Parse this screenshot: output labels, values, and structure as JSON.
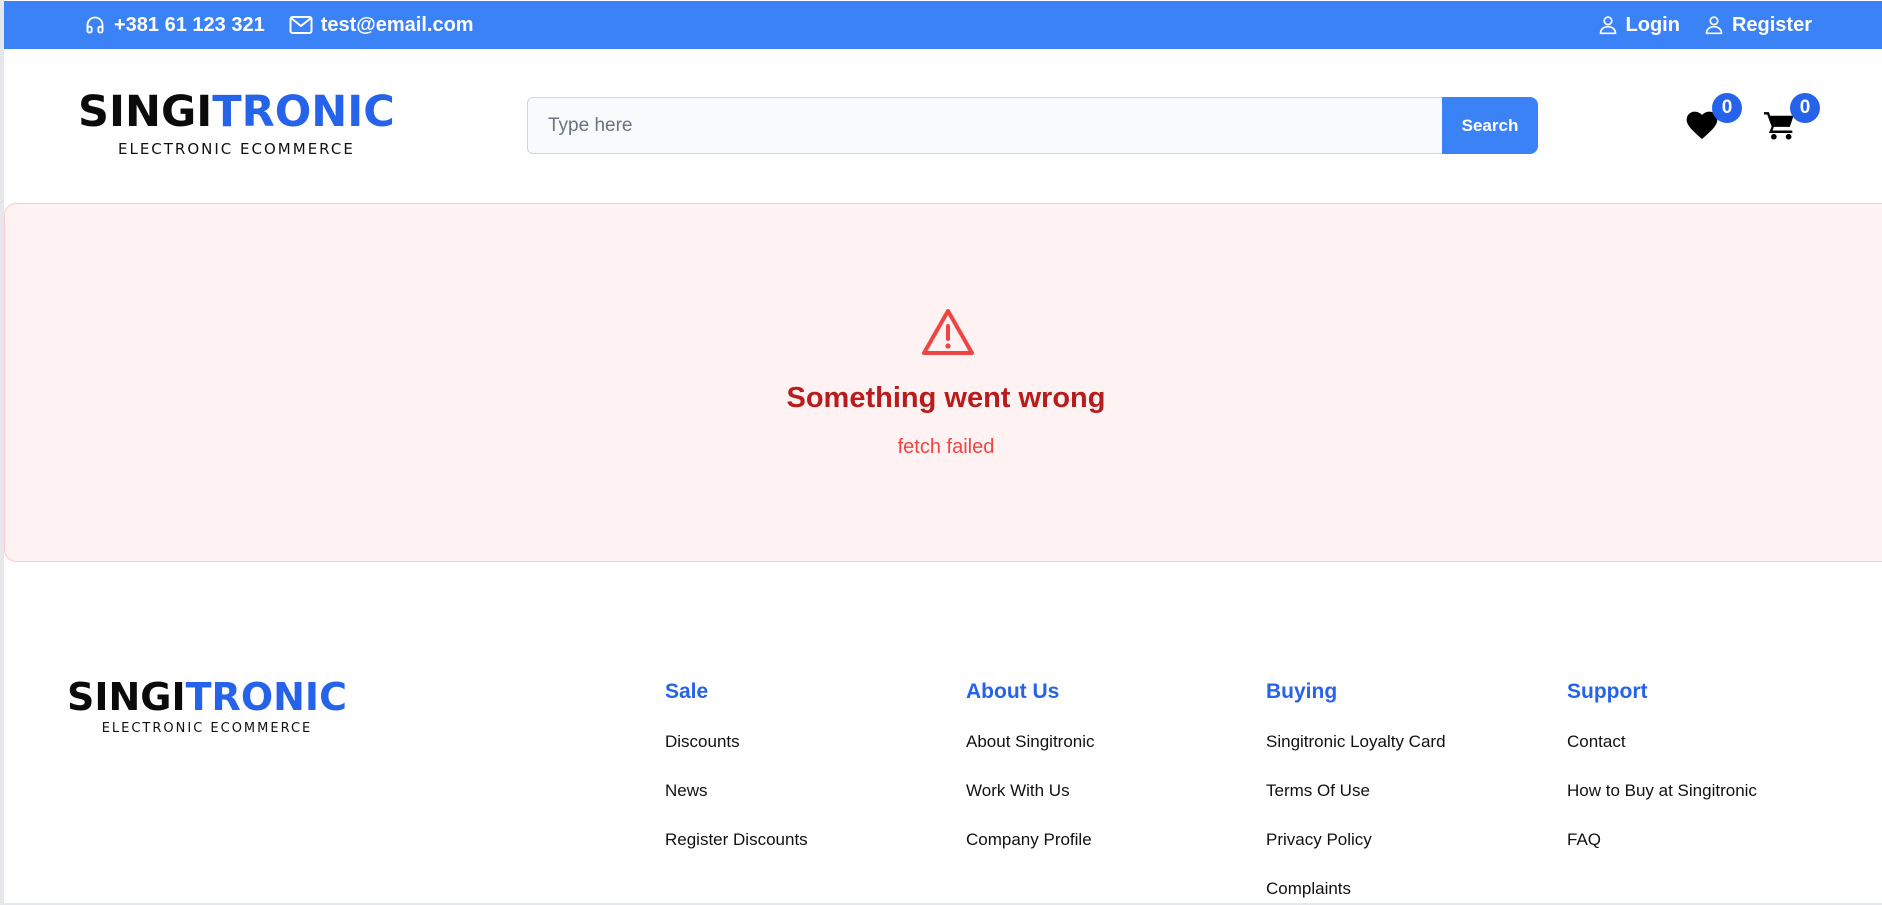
{
  "topbar": {
    "phone": "+381 61 123 321",
    "email": "test@email.com",
    "login": "Login",
    "register": "Register",
    "icons": [
      "headphones-icon",
      "mail-icon",
      "user-icon",
      "user-icon"
    ]
  },
  "brand": {
    "name_part1": "SINGI",
    "name_part2": "TRONIC",
    "tagline": "ELECTRONIC ECOMMERCE"
  },
  "search": {
    "placeholder": "Type here",
    "value": "",
    "button": "Search"
  },
  "wishlist": {
    "count": "0",
    "icon": "heart-icon"
  },
  "cart": {
    "count": "0",
    "icon": "cart-icon"
  },
  "error": {
    "icon": "warning-triangle-icon",
    "title": "Something went wrong",
    "message": "fetch failed"
  },
  "footer": {
    "columns": [
      {
        "title": "Sale",
        "links": [
          "Discounts",
          "News",
          "Register Discounts"
        ]
      },
      {
        "title": "About Us",
        "links": [
          "About Singitronic",
          "Work With Us",
          "Company Profile"
        ]
      },
      {
        "title": "Buying",
        "links": [
          "Singitronic Loyalty Card",
          "Terms Of Use",
          "Privacy Policy",
          "Complaints"
        ]
      },
      {
        "title": "Support",
        "links": [
          "Contact",
          "How to Buy at Singitronic",
          "FAQ"
        ]
      }
    ]
  },
  "colors": {
    "primary": "#3b82f6",
    "brand_blue": "#2563eb",
    "error_bg": "#fef2f2",
    "error_title": "#b91c1c",
    "error_text": "#ef4444"
  }
}
